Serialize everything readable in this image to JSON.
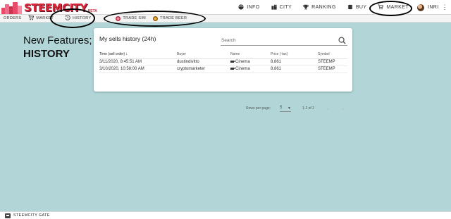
{
  "brand": {
    "name": "STEEMCITY",
    "badge": "BETA"
  },
  "topnav": [
    {
      "label": "INFO",
      "icon": "palette-icon"
    },
    {
      "label": "CITY",
      "icon": "city-icon"
    },
    {
      "label": "RANKING",
      "icon": "trophy-icon"
    },
    {
      "label": "BUY",
      "icon": "coins-icon"
    },
    {
      "label": "MARKET",
      "icon": "cart-icon"
    }
  ],
  "user": {
    "name": "INRI"
  },
  "subnav": [
    {
      "label": "ORDERS"
    },
    {
      "label": "MARKET",
      "icon": "cart-icon"
    },
    {
      "label": "HISTORY",
      "icon": "history-icon"
    },
    {
      "label": "TRADE SIM",
      "icon": "sim-coin-icon"
    },
    {
      "label": "TRADE BEER",
      "icon": "beer-coin-icon"
    }
  ],
  "headline": {
    "line1": "New Features;",
    "line2": "HISTORY"
  },
  "card": {
    "title": "My sells history (24h)",
    "search_placeholder": "Search",
    "columns": [
      "Time (sell order)",
      "Buyer",
      "Name",
      "Price (-tax)",
      "Symbol"
    ],
    "rows": [
      {
        "time": "3/11/2020, 8:45:51 AM",
        "buyer": "dustindivitto",
        "name": "Cinema",
        "price": "8.861",
        "symbol": "STEEMP"
      },
      {
        "time": "3/10/2020, 10:58:00 AM",
        "buyer": "cryptomarketer",
        "name": "Cinema",
        "price": "8.861",
        "symbol": "STEEMP"
      }
    ],
    "pager": {
      "rows_label": "Rows per page:",
      "rows_value": "5",
      "range": "1-2 of 2"
    }
  },
  "footer": {
    "label": "STEEMCITY GATE"
  },
  "colors": {
    "background": "#b2d6d8",
    "brand_red": "#d9263b"
  }
}
